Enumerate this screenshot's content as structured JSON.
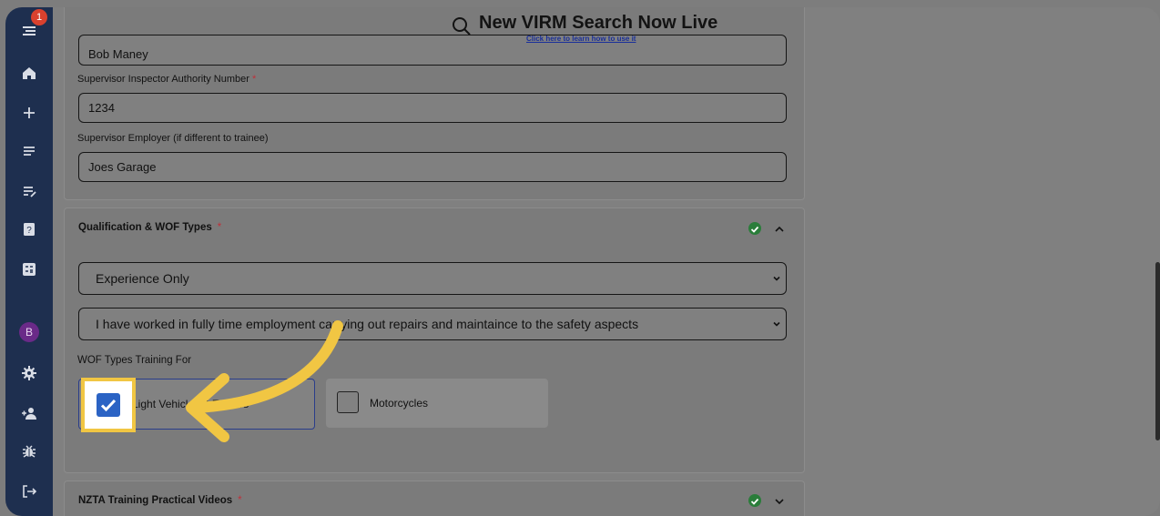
{
  "sidebar": {
    "notification_count": "1",
    "avatar_letter": "B",
    "icons": [
      "menu-icon",
      "home-icon",
      "plus-icon",
      "list-icon",
      "edit-list-icon",
      "help-book-icon",
      "calculator-icon",
      "settings-icon",
      "add-user-icon",
      "bug-icon",
      "logout-icon"
    ]
  },
  "header": {
    "title": "New VIRM Search Now Live",
    "link": "Click here to learn how to use it"
  },
  "supervisor": {
    "name_value": "Bob Maney",
    "authority_label": "Supervisor Inspector Authority Number",
    "authority_required": "*",
    "authority_value": "1234",
    "employer_label": "Supervisor Employer (if different to trainee)",
    "employer_value": "Joes Garage"
  },
  "qualification": {
    "title": "Qualification & WOF Types",
    "required": "*",
    "status": "complete",
    "select1_value": "Experience Only",
    "select2_value": "I have worked in fully time employment carrying out repairs and maintaince to the safety aspects",
    "wof_types_label": "WOF Types Training For",
    "option1_label": "Light Vehicles & Trailers",
    "option1_checked": true,
    "option2_label": "Motorcycles",
    "option2_checked": false
  },
  "nzta": {
    "title": "NZTA Training Practical Videos",
    "required": "*",
    "status": "complete"
  },
  "colors": {
    "sidebar": "#1e2f4f",
    "highlight": "#f1c643",
    "arrow": "#f1c643",
    "checkbox": "#2b63c4",
    "success": "#2a7d3a"
  }
}
